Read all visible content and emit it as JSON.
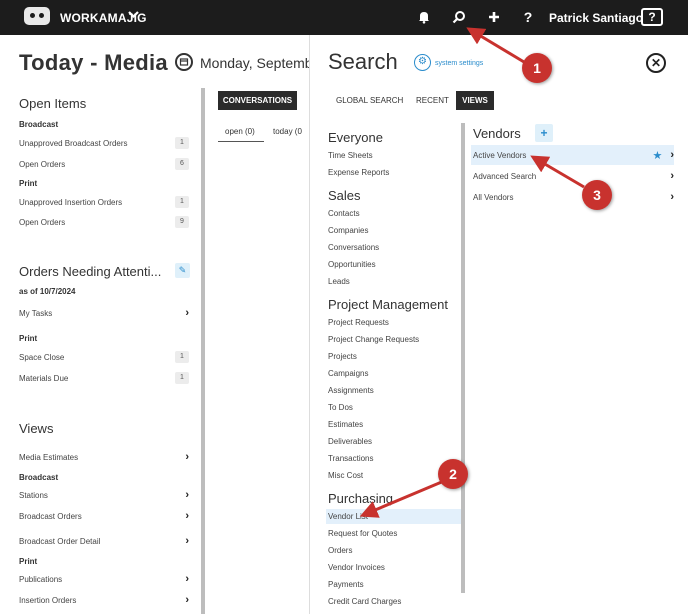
{
  "topbar": {
    "brand": "WORKAMAJIG",
    "user": "Patrick Santiago",
    "help": "?"
  },
  "page": {
    "title": "Today - Media",
    "date": "Monday, September"
  },
  "open_items": {
    "heading": "Open Items",
    "groups": [
      {
        "label": "Broadcast",
        "rows": [
          {
            "label": "Unapproved Broadcast Orders",
            "count": "1"
          },
          {
            "label": "Open Orders",
            "count": "6"
          }
        ]
      },
      {
        "label": "Print",
        "rows": [
          {
            "label": "Unapproved Insertion Orders",
            "count": "1"
          },
          {
            "label": "Open Orders",
            "count": "9"
          }
        ]
      }
    ]
  },
  "attention": {
    "heading": "Orders Needing Attenti...",
    "as_of": "as of 10/7/2024",
    "my_tasks": "My Tasks",
    "group": "Print",
    "rows": [
      {
        "label": "Space Close",
        "count": "1"
      },
      {
        "label": "Materials Due",
        "count": "1"
      }
    ]
  },
  "views": {
    "heading": "Views",
    "media_estimates": "Media Estimates",
    "broadcast_group": "Broadcast",
    "stations": "Stations",
    "broadcast_orders": "Broadcast Orders",
    "broadcast_order_detail": "Broadcast Order Detail",
    "print_group": "Print",
    "publications": "Publications",
    "insertion_orders": "Insertion Orders"
  },
  "middle": {
    "tab": "CONVERSATIONS",
    "sub_open": "open (0)",
    "sub_today": "today (0"
  },
  "search": {
    "title": "Search",
    "system_settings": "system settings",
    "tabs": [
      "GLOBAL SEARCH",
      "RECENT",
      "VIEWS"
    ],
    "categories": {
      "everyone": {
        "heading": "Everyone",
        "items": [
          "Time Sheets",
          "Expense Reports"
        ]
      },
      "sales": {
        "heading": "Sales",
        "items": [
          "Contacts",
          "Companies",
          "Conversations",
          "Opportunities",
          "Leads"
        ]
      },
      "pm": {
        "heading": "Project Management",
        "items": [
          "Project Requests",
          "Project Change Requests",
          "Projects",
          "Campaigns",
          "Assignments",
          "To Dos",
          "Estimates",
          "Deliverables",
          "Transactions",
          "Misc Cost"
        ]
      },
      "purchasing": {
        "heading": "Purchasing",
        "items": [
          "Vendor List",
          "Request for Quotes",
          "Orders",
          "Vendor Invoices",
          "Payments",
          "Credit Card Charges"
        ]
      }
    },
    "vendors": {
      "heading": "Vendors",
      "rows": [
        "Active Vendors",
        "Advanced Search",
        "All Vendors"
      ]
    }
  },
  "annotations": [
    "1",
    "2",
    "3"
  ],
  "colors": {
    "accent": "#2a8ccc",
    "marker": "#c8322e",
    "topbar": "#1c1c1c",
    "highlight": "#e3f0fb"
  }
}
